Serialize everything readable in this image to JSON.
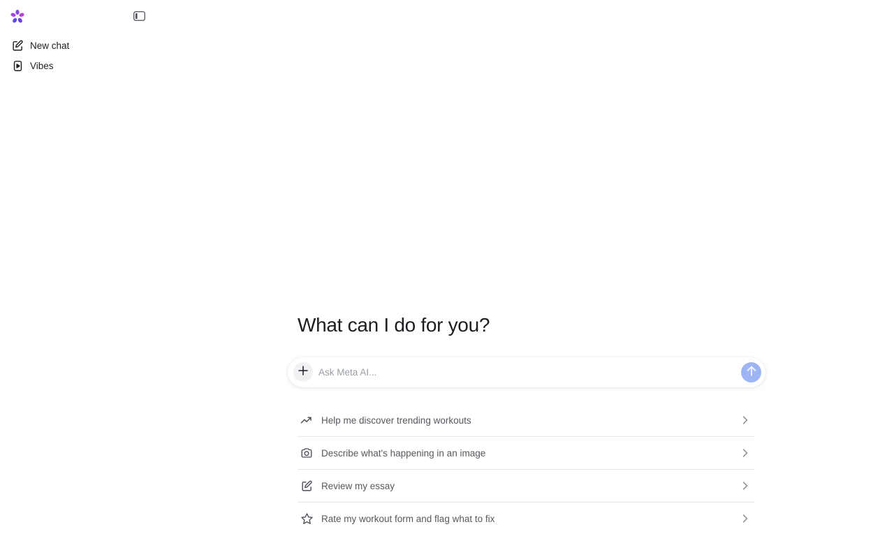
{
  "sidebar": {
    "logo_icon": "meta-ai-flower-logo",
    "toggle_icon": "sidebar-toggle-icon",
    "items": [
      {
        "label": "New chat",
        "icon": "edit-icon"
      },
      {
        "label": "Vibes",
        "icon": "video-play-icon"
      }
    ]
  },
  "main": {
    "headline": "What can I do for you?",
    "composer": {
      "placeholder": "Ask Meta AI...",
      "plus_icon": "plus-icon",
      "send_icon": "arrow-up-icon",
      "send_color": "#9db4f5"
    },
    "suggestions": [
      {
        "label": "Help me discover trending workouts",
        "icon": "trending-up-icon"
      },
      {
        "label": "Describe what's happening in an image",
        "icon": "camera-icon"
      },
      {
        "label": "Review my essay",
        "icon": "edit-icon"
      },
      {
        "label": "Rate my workout form and flag what to fix",
        "icon": "star-icon"
      }
    ]
  },
  "colors": {
    "logo_purple": "#7b3fe4",
    "logo_pink": "#c13ad1",
    "logo_blue": "#5a4be8",
    "text_primary": "#1c1e21",
    "text_secondary": "#55585e",
    "divider": "#e4e6eb"
  }
}
